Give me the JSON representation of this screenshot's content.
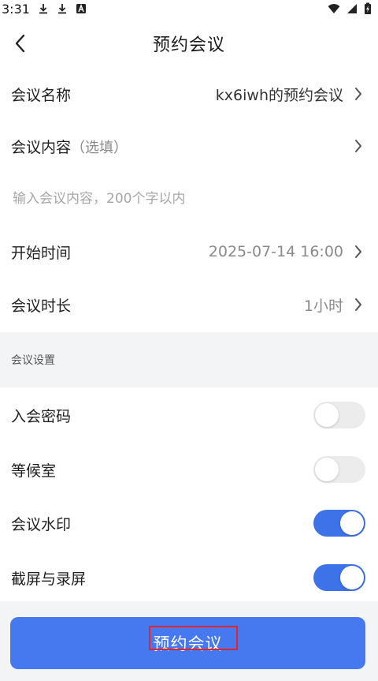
{
  "status_bar": {
    "time": "3:31",
    "left_icons": [
      "download-icon",
      "download-icon",
      "a-badge-icon"
    ],
    "right_icons": [
      "wifi-icon",
      "signal-icon",
      "battery-charging-icon"
    ]
  },
  "header": {
    "title": "预约会议",
    "back_icon": "chevron-left-icon"
  },
  "rows": {
    "meeting_name": {
      "label": "会议名称",
      "value": "kx6iwh的预约会议"
    },
    "meeting_content": {
      "label": "会议内容",
      "hint": "（选填）"
    },
    "content_input": {
      "placeholder": "输入会议内容，200个字以内",
      "value": ""
    },
    "start_time": {
      "label": "开始时间",
      "value": "2025-07-14 16:00"
    },
    "duration": {
      "label": "会议时长",
      "value": "1小时"
    }
  },
  "settings": {
    "section_title": "会议设置",
    "items": [
      {
        "label": "入会密码",
        "enabled": false
      },
      {
        "label": "等候室",
        "enabled": false
      },
      {
        "label": "会议水印",
        "enabled": true
      },
      {
        "label": "截屏与录屏",
        "enabled": true
      }
    ]
  },
  "submit": {
    "label": "预约会议"
  },
  "colors": {
    "accent": "#4679f0",
    "toggle_on": "#3d72e8",
    "toggle_off": "#ececec",
    "section_bg": "#f3f4f6",
    "highlight": "#e0262a"
  }
}
